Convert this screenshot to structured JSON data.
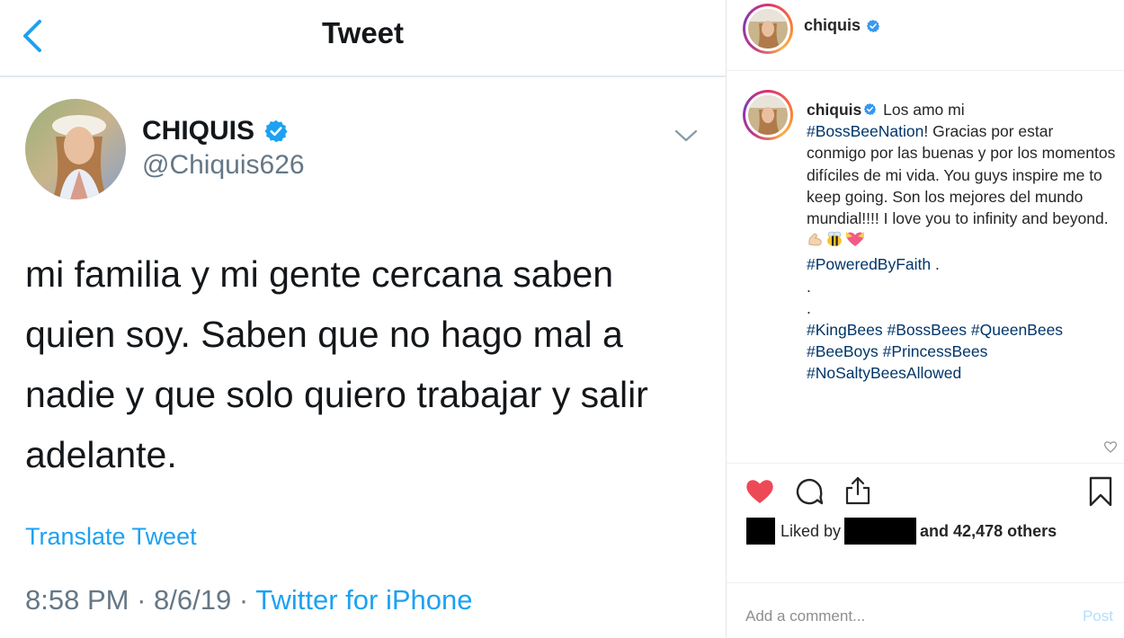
{
  "tweet": {
    "header_title": "Tweet",
    "display_name": "CHIQUIS",
    "handle": "@Chiquis626",
    "lines": [
      "mi familia y mi gente cercana saben",
      "quien soy. Saben que no hago mal a",
      "nadie y que solo quiero trabajar y salir",
      "adelante."
    ],
    "translate_label": "Translate Tweet",
    "time": "8:58 PM",
    "date": "8/6/19",
    "separator": "·",
    "source": "Twitter for iPhone",
    "colors": {
      "link": "#1da1f2",
      "muted": "#657786"
    }
  },
  "instagram": {
    "username": "chiquis",
    "caption": {
      "intro": "Los amo mi",
      "tag1": "#BossBeeNation",
      "body": "! Gracias por estar conmigo por las buenas y por los momentos difíciles de mi vida. You guys inspire me to keep going. Son los mejores del mundo mundial!!!! I love you to infinity and beyond.",
      "tag2": "#PoweredByFaith",
      "tag2_suffix": " .",
      "dot1": ".",
      "dot2": ".",
      "tags_line1": "#KingBees #BossBees #QueenBees",
      "tags_line2": "#BeeBoys #PrincessBees",
      "tags_line3": "#NoSaltyBeesAllowed"
    },
    "liked_by_label": "Liked by",
    "and_others": "and 42,478 others",
    "comment_placeholder": "Add a comment...",
    "post_label": "Post",
    "icons": [
      "heart-icon",
      "comment-icon",
      "share-icon",
      "bookmark-icon",
      "verified-icon"
    ],
    "colors": {
      "hashtag": "#003569",
      "like": "#ed4956",
      "post": "#b2dffc"
    }
  }
}
